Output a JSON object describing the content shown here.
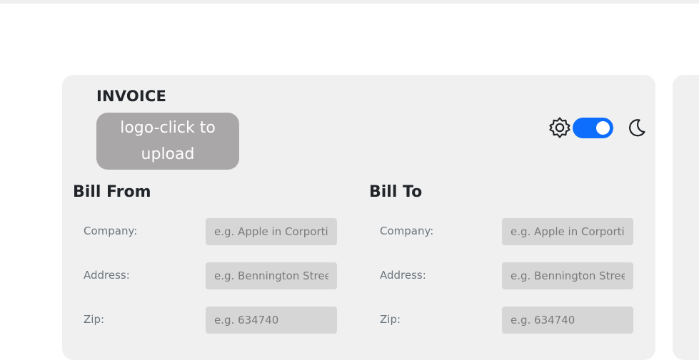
{
  "invoice": {
    "title": "INVOICE",
    "logo_upload_label": "logo-click to upload"
  },
  "theme": {
    "light_icon": "gear-sun-icon",
    "dark_icon": "moon-icon",
    "toggle_on": true,
    "accent_color": "#0d6efd"
  },
  "bill_from": {
    "title": "Bill From",
    "fields": [
      {
        "label": "Company:",
        "placeholder": "e.g. Apple in Corportion",
        "value": ""
      },
      {
        "label": "Address:",
        "placeholder": "e.g. Bennington Street",
        "value": ""
      },
      {
        "label": "Zip:",
        "placeholder": "e.g. 634740",
        "value": ""
      }
    ]
  },
  "bill_to": {
    "title": "Bill To",
    "fields": [
      {
        "label": "Company:",
        "placeholder": "e.g. Apple in Corportion",
        "value": ""
      },
      {
        "label": "Address:",
        "placeholder": "e.g. Bennington Street",
        "value": ""
      },
      {
        "label": "Zip:",
        "placeholder": "e.g. 634740",
        "value": ""
      }
    ]
  }
}
